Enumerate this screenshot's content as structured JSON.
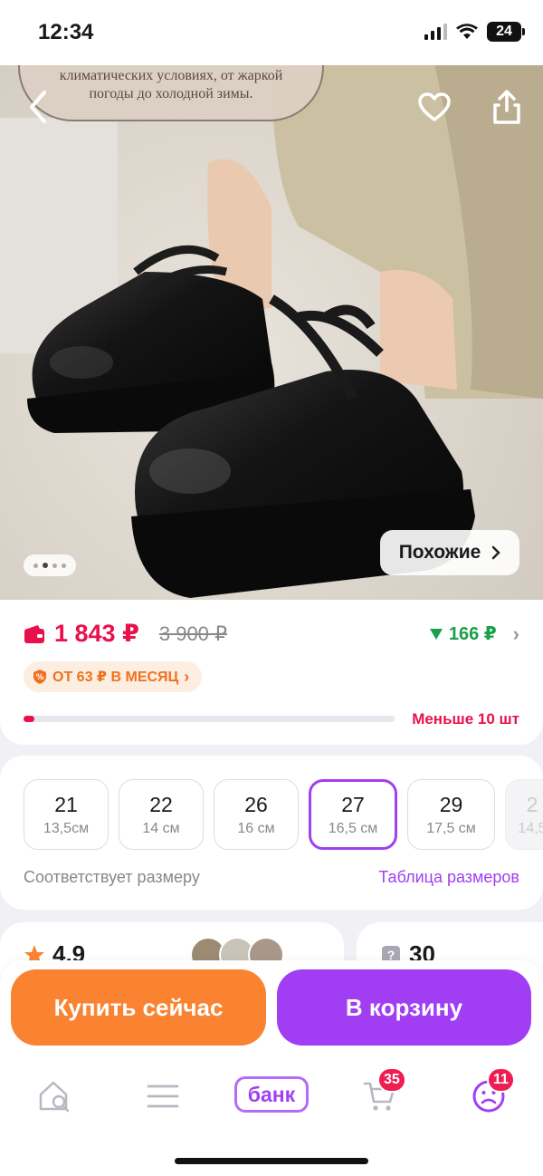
{
  "status_bar": {
    "time": "12:34",
    "battery": "24"
  },
  "product_image": {
    "banner_text_line1": "климатических условиях, от жаркой",
    "banner_text_line2": "погоды до холодной зимы.",
    "similar_label": "Похожие",
    "page_dots_total": 4,
    "page_dots_active": 1
  },
  "price": {
    "current": "1 843 ₽",
    "old": "3 900 ₽",
    "cashback": "166 ₽",
    "installment": "ОТ 63 ₽ В МЕСЯЦ",
    "stock_text": "Меньше 10 шт",
    "stock_level": 0.03
  },
  "sizes": {
    "items": [
      {
        "size": "21",
        "cm": "13,5см"
      },
      {
        "size": "22",
        "cm": "14 см"
      },
      {
        "size": "26",
        "cm": "16 см"
      },
      {
        "size": "27",
        "cm": "16,5 см"
      },
      {
        "size": "29",
        "cm": "17,5 см"
      },
      {
        "size": "2",
        "cm": "14,5"
      }
    ],
    "selected_index": 3,
    "fit_text": "Соответствует размеру",
    "chart_link": "Таблица размеров"
  },
  "reviews": {
    "rating": "4,9",
    "questions": "30"
  },
  "actions": {
    "buy_now": "Купить сейчас",
    "add_to_cart": "В корзину"
  },
  "tabbar": {
    "bank_label": "банк",
    "cart_badge": "35",
    "profile_badge": "11"
  },
  "colors": {
    "price": "#e8114b",
    "accent": "#a13ef4",
    "buy": "#f98331",
    "cashback": "#18a14a"
  }
}
